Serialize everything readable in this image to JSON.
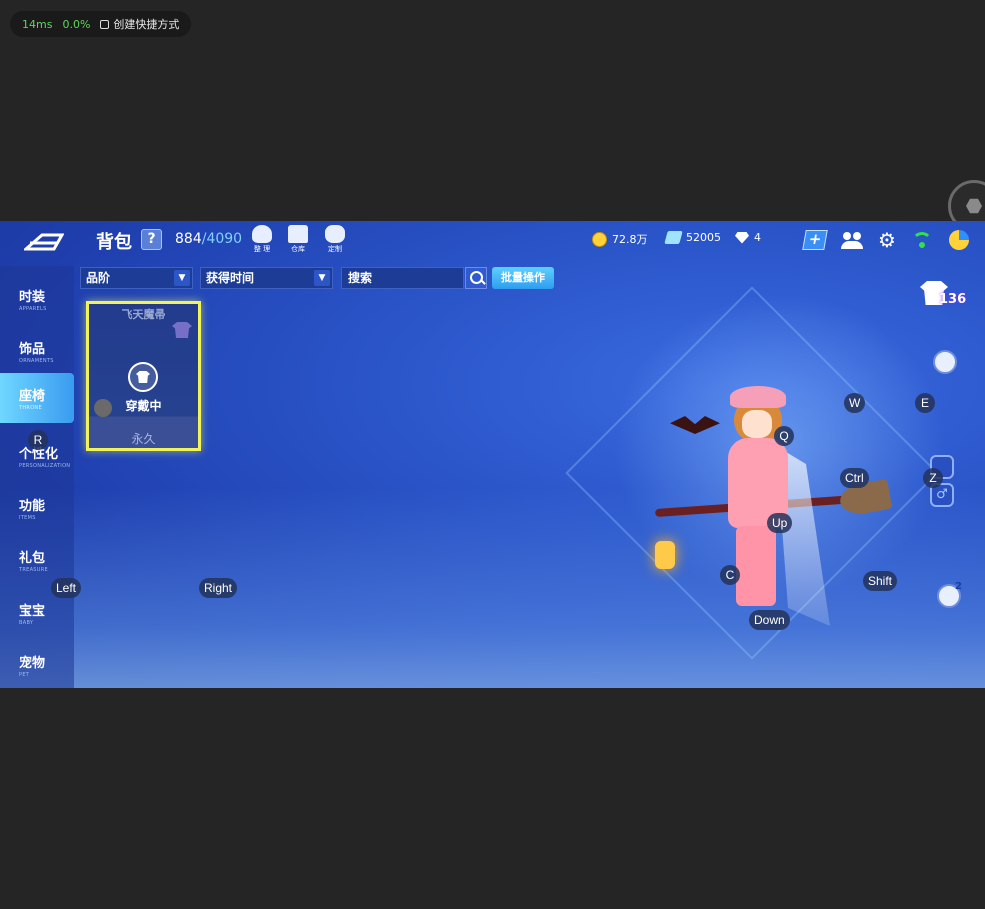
{
  "overlay": {
    "latency": "14ms",
    "loss": "0.0%",
    "shortcut_label": "创建快捷方式"
  },
  "header": {
    "title": "背包",
    "help": "?",
    "count_used": "884",
    "count_cap": "/4090",
    "tools": [
      {
        "icon": "organize-icon",
        "label": "整 理"
      },
      {
        "icon": "warehouse-icon",
        "label": "仓库"
      },
      {
        "icon": "customize-icon",
        "label": "定制"
      }
    ],
    "currencies": {
      "coins": "72.8万",
      "tickets": "52005",
      "diamonds": "4"
    }
  },
  "sidebar": {
    "items": [
      {
        "cn": "时装",
        "en": "APPARELS"
      },
      {
        "cn": "饰品",
        "en": "ORNAMENTS"
      },
      {
        "cn": "座椅",
        "en": "THRONE"
      },
      {
        "cn": "个性化",
        "en": "PERSONALIZATION"
      },
      {
        "cn": "功能",
        "en": "ITEMS"
      },
      {
        "cn": "礼包",
        "en": "TREASURE"
      },
      {
        "cn": "宝宝",
        "en": "BABY"
      },
      {
        "cn": "宠物",
        "en": "PET"
      }
    ],
    "active_index": 2
  },
  "filters": {
    "grade": "品阶",
    "time": "获得时间",
    "search_placeholder": "搜索",
    "batch": "批量操作"
  },
  "item": {
    "name": "飞天魔帚",
    "status": "穿戴中",
    "duration": "永久"
  },
  "right_panel": {
    "outfit_count": "136",
    "badge": "2",
    "gender": "♂"
  },
  "keys": {
    "r": "R",
    "w": "W",
    "e": "E",
    "q": "Q",
    "ctrl": "Ctrl",
    "z": "Z",
    "up": "Up",
    "left": "Left",
    "right": "Right",
    "c": "C",
    "shift": "Shift",
    "down": "Down"
  },
  "colors": {
    "accent": "#3a9bf0",
    "selected_border": "#f2f25a",
    "latency": "#5cd65c"
  }
}
